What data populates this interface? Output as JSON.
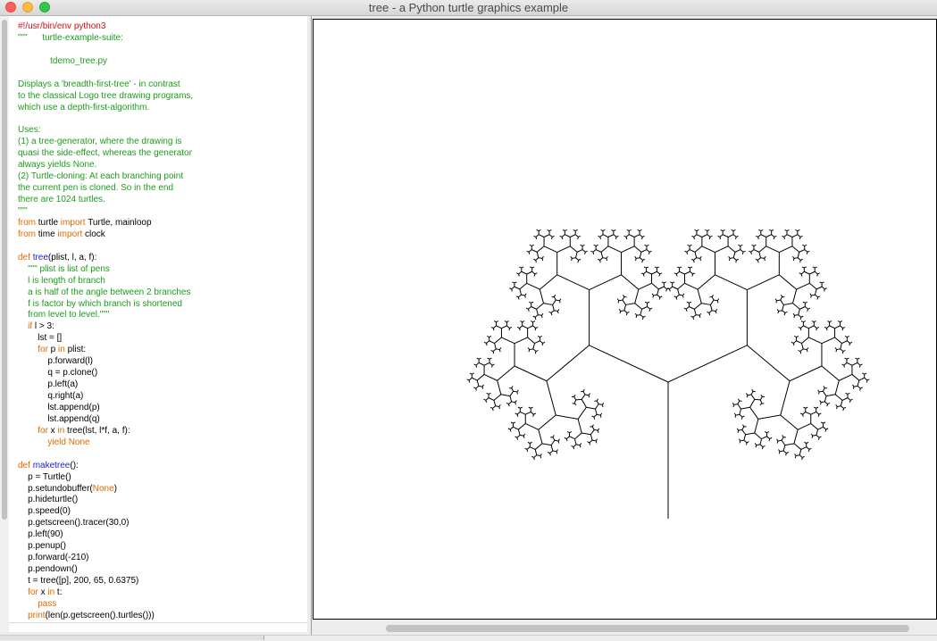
{
  "window": {
    "title": "tree - a Python turtle graphics example"
  },
  "code_lines": [
    [
      {
        "t": "#!/usr/bin/env python3",
        "c": "red"
      }
    ],
    [
      {
        "t": "\"\"\"      turtle-example-suite:",
        "c": "green"
      }
    ],
    [
      {
        "t": "",
        "c": ""
      }
    ],
    [
      {
        "t": "             tdemo_tree.py",
        "c": "green"
      }
    ],
    [
      {
        "t": "",
        "c": ""
      }
    ],
    [
      {
        "t": "Displays a 'breadth-first-tree' - in contrast",
        "c": "green"
      }
    ],
    [
      {
        "t": "to the classical Logo tree drawing programs,",
        "c": "green"
      }
    ],
    [
      {
        "t": "which use a depth-first-algorithm.",
        "c": "green"
      }
    ],
    [
      {
        "t": "",
        "c": ""
      }
    ],
    [
      {
        "t": "Uses:",
        "c": "green"
      }
    ],
    [
      {
        "t": "(1) a tree-generator, where the drawing is",
        "c": "green"
      }
    ],
    [
      {
        "t": "quasi the side-effect, whereas the generator",
        "c": "green"
      }
    ],
    [
      {
        "t": "always yields None.",
        "c": "green"
      }
    ],
    [
      {
        "t": "(2) Turtle-cloning: At each branching point",
        "c": "green"
      }
    ],
    [
      {
        "t": "the current pen is cloned. So in the end",
        "c": "green"
      }
    ],
    [
      {
        "t": "there are 1024 turtles.",
        "c": "green"
      }
    ],
    [
      {
        "t": "\"\"\"",
        "c": "green"
      }
    ],
    [
      {
        "t": "from",
        "c": "orange"
      },
      {
        "t": " turtle ",
        "c": ""
      },
      {
        "t": "import",
        "c": "orange"
      },
      {
        "t": " Turtle, mainloop",
        "c": ""
      }
    ],
    [
      {
        "t": "from",
        "c": "orange"
      },
      {
        "t": " time ",
        "c": ""
      },
      {
        "t": "import",
        "c": "orange"
      },
      {
        "t": " clock",
        "c": ""
      }
    ],
    [
      {
        "t": "",
        "c": ""
      }
    ],
    [
      {
        "t": "def",
        "c": "orange"
      },
      {
        "t": " ",
        "c": ""
      },
      {
        "t": "tree",
        "c": "blue"
      },
      {
        "t": "(plist, l, a, f):",
        "c": ""
      }
    ],
    [
      {
        "t": "    ",
        "c": ""
      },
      {
        "t": "\"\"\" plist is list of pens",
        "c": "green"
      }
    ],
    [
      {
        "t": "    l is length of branch",
        "c": "green"
      }
    ],
    [
      {
        "t": "    a is half of the angle between 2 branches",
        "c": "green"
      }
    ],
    [
      {
        "t": "    f is factor by which branch is shortened",
        "c": "green"
      }
    ],
    [
      {
        "t": "    from level to level.\"\"\"",
        "c": "green"
      }
    ],
    [
      {
        "t": "    ",
        "c": ""
      },
      {
        "t": "if",
        "c": "orange"
      },
      {
        "t": " l > 3:",
        "c": ""
      }
    ],
    [
      {
        "t": "        lst = []",
        "c": ""
      }
    ],
    [
      {
        "t": "        ",
        "c": ""
      },
      {
        "t": "for",
        "c": "orange"
      },
      {
        "t": " p ",
        "c": ""
      },
      {
        "t": "in",
        "c": "orange"
      },
      {
        "t": " plist:",
        "c": ""
      }
    ],
    [
      {
        "t": "            p.forward(l)",
        "c": ""
      }
    ],
    [
      {
        "t": "            q = p.clone()",
        "c": ""
      }
    ],
    [
      {
        "t": "            p.left(a)",
        "c": ""
      }
    ],
    [
      {
        "t": "            q.right(a)",
        "c": ""
      }
    ],
    [
      {
        "t": "            lst.append(p)",
        "c": ""
      }
    ],
    [
      {
        "t": "            lst.append(q)",
        "c": ""
      }
    ],
    [
      {
        "t": "        ",
        "c": ""
      },
      {
        "t": "for",
        "c": "orange"
      },
      {
        "t": " x ",
        "c": ""
      },
      {
        "t": "in",
        "c": "orange"
      },
      {
        "t": " tree(lst, l*f, a, f):",
        "c": ""
      }
    ],
    [
      {
        "t": "            ",
        "c": ""
      },
      {
        "t": "yield None",
        "c": "orange"
      }
    ],
    [
      {
        "t": "",
        "c": ""
      }
    ],
    [
      {
        "t": "def",
        "c": "orange"
      },
      {
        "t": " ",
        "c": ""
      },
      {
        "t": "maketree",
        "c": "blue"
      },
      {
        "t": "():",
        "c": ""
      }
    ],
    [
      {
        "t": "    p = Turtle()",
        "c": ""
      }
    ],
    [
      {
        "t": "    p.setundobuffer(",
        "c": ""
      },
      {
        "t": "None",
        "c": "orange"
      },
      {
        "t": ")",
        "c": ""
      }
    ],
    [
      {
        "t": "    p.hideturtle()",
        "c": ""
      }
    ],
    [
      {
        "t": "    p.speed(0)",
        "c": ""
      }
    ],
    [
      {
        "t": "    p.getscreen().tracer(30,0)",
        "c": ""
      }
    ],
    [
      {
        "t": "    p.left(90)",
        "c": ""
      }
    ],
    [
      {
        "t": "    p.penup()",
        "c": ""
      }
    ],
    [
      {
        "t": "    p.forward(-210)",
        "c": ""
      }
    ],
    [
      {
        "t": "    p.pendown()",
        "c": ""
      }
    ],
    [
      {
        "t": "    t = tree([p], 200, 65, 0.6375)",
        "c": ""
      }
    ],
    [
      {
        "t": "    ",
        "c": ""
      },
      {
        "t": "for",
        "c": "orange"
      },
      {
        "t": " x ",
        "c": ""
      },
      {
        "t": "in",
        "c": "orange"
      },
      {
        "t": " t:",
        "c": ""
      }
    ],
    [
      {
        "t": "        pass",
        "c": "orange"
      }
    ],
    [
      {
        "t": "    ",
        "c": ""
      },
      {
        "t": "print",
        "c": "orange"
      },
      {
        "t": "(len(p.getscreen().turtles()))",
        "c": ""
      }
    ]
  ],
  "tree_params": {
    "length": 200,
    "angle": 65,
    "factor": 0.6375,
    "min_length": 3
  },
  "colors": {
    "red_light": "#fc605c",
    "yellow_light": "#fdbc40",
    "green_light": "#34c84a",
    "code_red": "#d0121b",
    "code_green": "#1c9c1c",
    "code_orange": "#e26a00",
    "code_blue": "#1a1ad0"
  }
}
